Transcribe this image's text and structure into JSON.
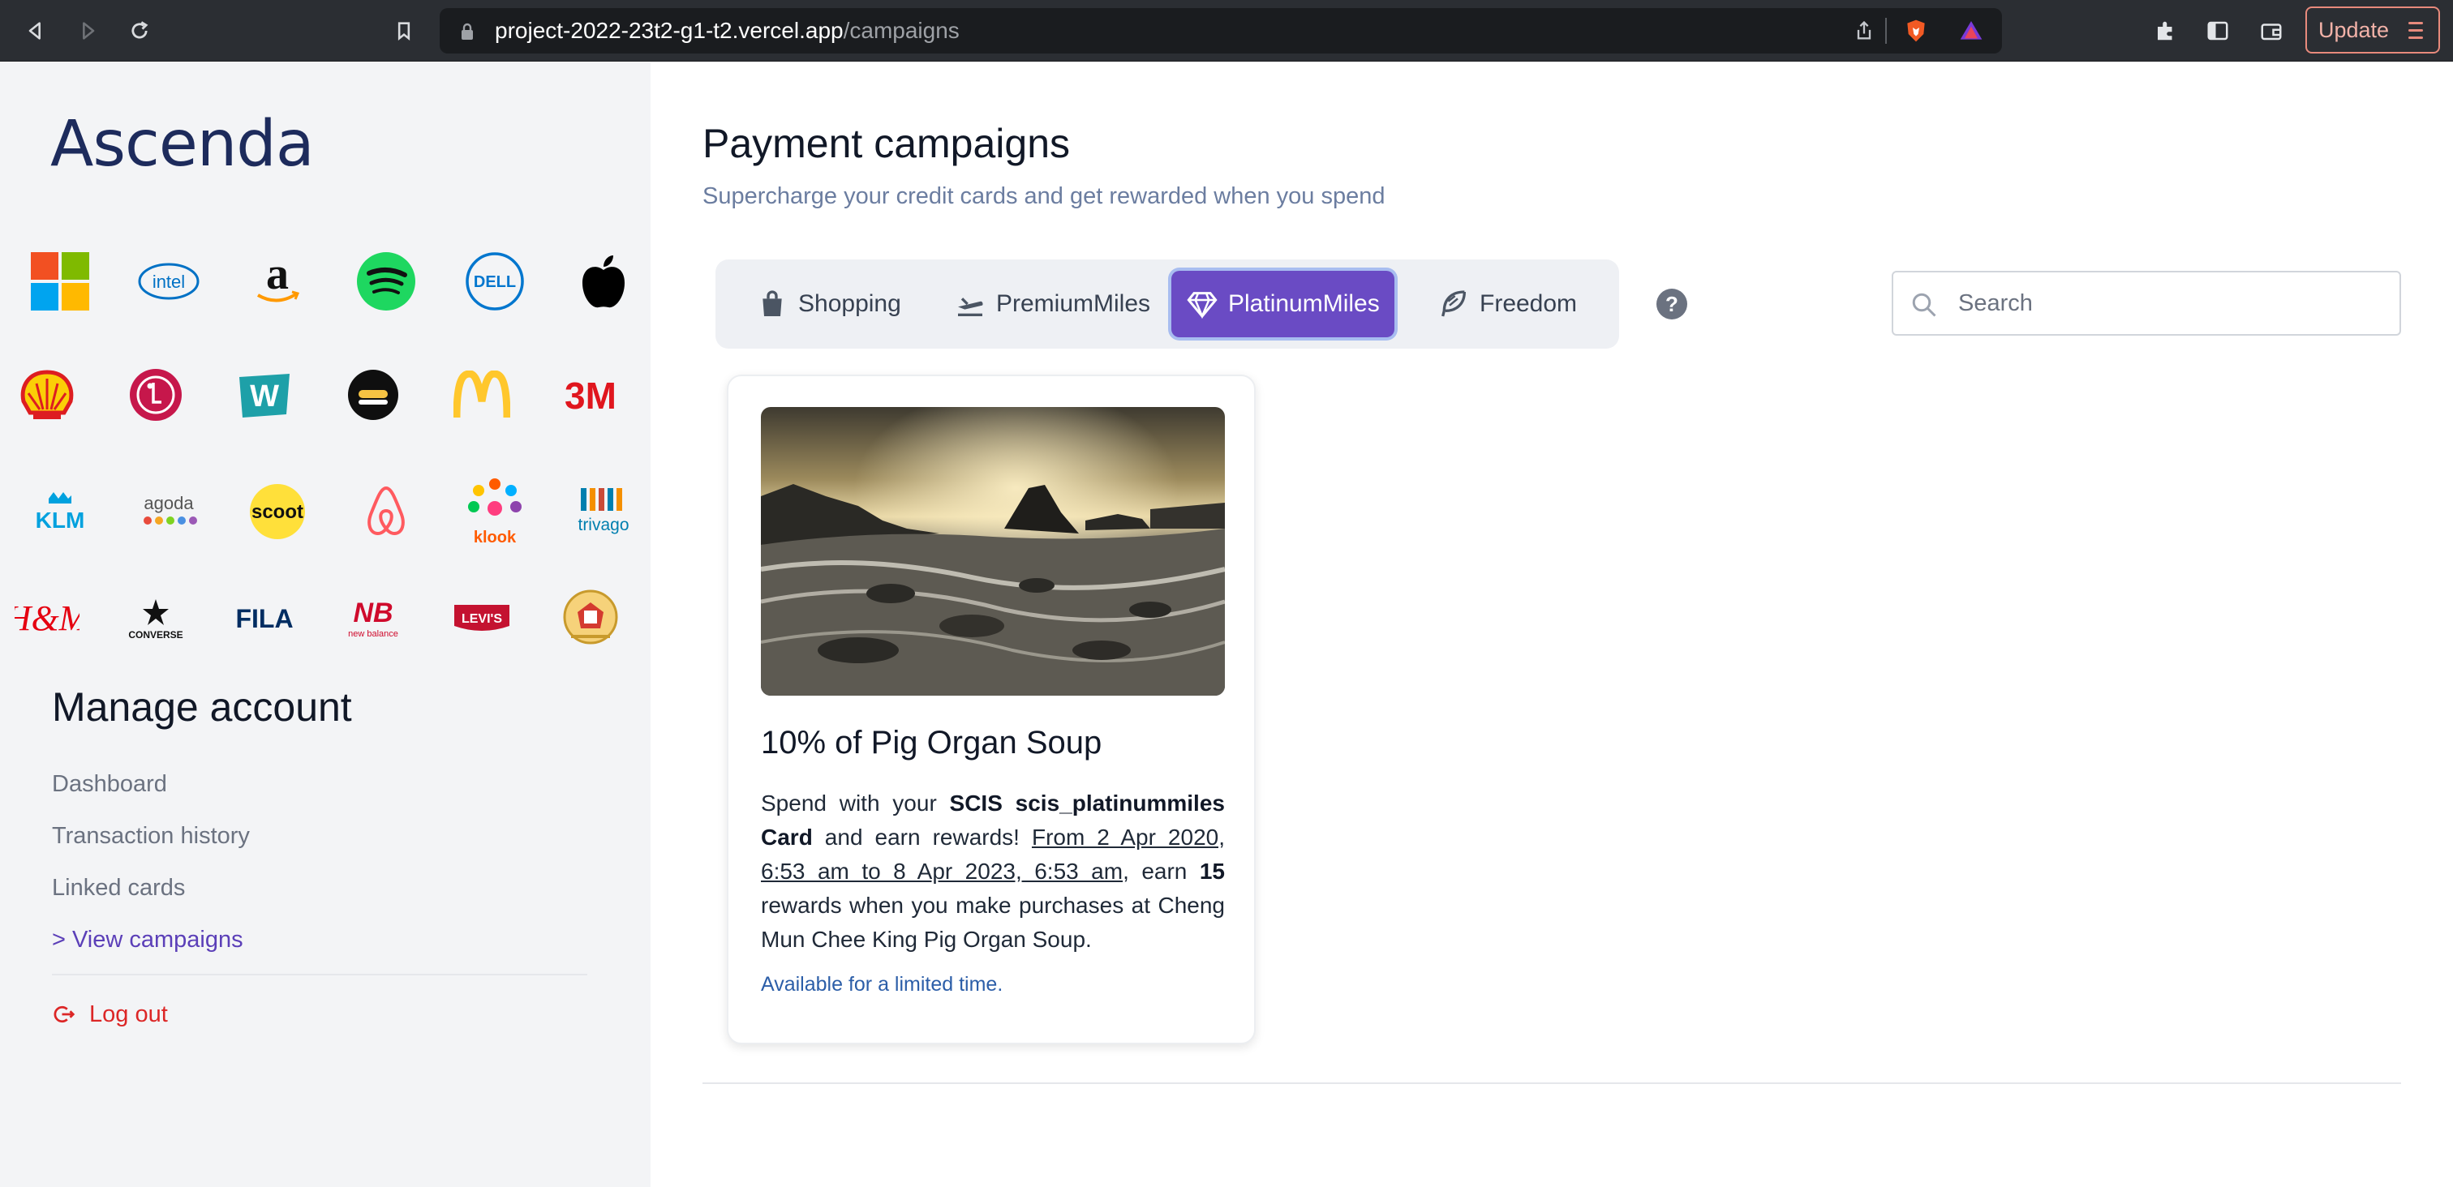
{
  "browser": {
    "url_host": "project-2022-23t2-g1-t2.vercel.app",
    "url_path": "/campaigns",
    "update_label": "Update"
  },
  "sidebar": {
    "brand": "Ascenda",
    "logos": [
      "microsoft",
      "intel",
      "amazon",
      "spotify",
      "dell",
      "apple",
      "shell",
      "lg",
      "watsons",
      "grab",
      "mcdonalds",
      "3m",
      "klm",
      "agoda",
      "scoot",
      "airbnb",
      "klook",
      "trivago",
      "hm",
      "converse",
      "fila",
      "new-balance",
      "levis",
      "crest"
    ],
    "logo_texts": {
      "intel": "intel",
      "dell": "DELL",
      "w": "W",
      "3m": "3M",
      "klm": "KLM",
      "agoda": "agoda",
      "scoot": "scoot",
      "klook": "klook",
      "trivago": "trivago",
      "hm": "H&M",
      "converse": "CONVERSE",
      "fila": "FILA",
      "nb": "new balance",
      "levis": "LEVI'S"
    },
    "manage_title": "Manage account",
    "links": [
      {
        "label": "Dashboard"
      },
      {
        "label": "Transaction history"
      },
      {
        "label": "Linked cards"
      },
      {
        "label": "> View campaigns"
      }
    ],
    "logout_label": "Log out"
  },
  "main": {
    "title": "Payment campaigns",
    "subtitle": "Supercharge your credit cards and get rewarded when you spend",
    "tabs": [
      {
        "label": "Shopping",
        "icon": "bag-icon"
      },
      {
        "label": "PremiumMiles",
        "icon": "plane-icon"
      },
      {
        "label": "PlatinumMiles",
        "icon": "diamond-icon",
        "active": true
      },
      {
        "label": "Freedom",
        "icon": "feather-icon"
      }
    ],
    "help_label": "?",
    "search_placeholder": "Search",
    "card": {
      "title": "10% of Pig Organ Soup",
      "body_1": "Spend with your ",
      "card_name": "SCIS scis_platinummiles Card",
      "body_2": " and earn rewards! ",
      "period": "From 2 Apr 2020, 6:53 am to 8 Apr 2023, 6:53 am",
      "body_3": ", earn ",
      "points": "15",
      "body_4": " rewards when you make purchases at Cheng Mun Chee King Pig Organ Soup.",
      "note": "Available for a limited time."
    }
  },
  "colors": {
    "accent": "#6a4bc4",
    "brand": "#1d2b5c",
    "logout": "#dc2626"
  }
}
